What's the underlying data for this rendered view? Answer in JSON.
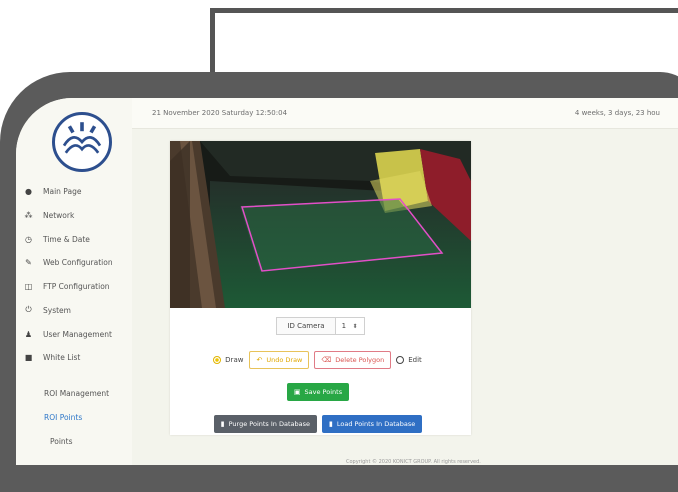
{
  "header": {
    "datetime": "21 November 2020 Saturday 12:50:04",
    "uptime": "4 weeks, 3 days, 23 hou"
  },
  "sidebar": {
    "items": [
      {
        "label": "Main Page",
        "icon": "info-icon"
      },
      {
        "label": "Network",
        "icon": "network-icon"
      },
      {
        "label": "Time & Date",
        "icon": "clock-icon"
      },
      {
        "label": "Web Configuration",
        "icon": "tools-icon"
      },
      {
        "label": "FTP Configuration",
        "icon": "ftp-icon"
      },
      {
        "label": "System",
        "icon": "power-icon"
      },
      {
        "label": "User Management",
        "icon": "users-icon"
      },
      {
        "label": "White List",
        "icon": "list-icon"
      },
      {
        "label": "ROI Management",
        "icon": ""
      },
      {
        "label": "ROI Points",
        "icon": ""
      },
      {
        "label": "Points",
        "icon": ""
      }
    ]
  },
  "camera_select": {
    "label": "ID Camera",
    "value": "1"
  },
  "mode": {
    "draw_label": "Draw",
    "undo_label": "Undo Draw",
    "delete_label": "Delete Polygon",
    "edit_label": "Edit"
  },
  "actions": {
    "save_label": "Save Points",
    "purge_label": "Purge Points In Database",
    "load_label": "Load Points In Database"
  },
  "footer": {
    "text": "Copyright © 2020 KONICT GROUP. All rights reserved."
  },
  "colors": {
    "active_link": "#2e77c9",
    "polygon": "#e24fc8",
    "success": "#28a745",
    "primary": "#2f6fc4"
  }
}
